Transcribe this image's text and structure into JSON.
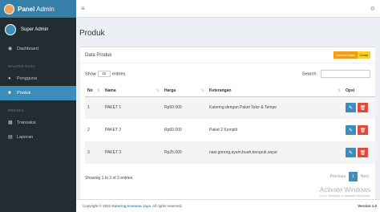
{
  "brand": {
    "bold": "Panel",
    "light": "Admin"
  },
  "user": {
    "name": "Super Admin"
  },
  "sidebar": {
    "dashboard": "Dashboard",
    "master_header": "MASTER DATA",
    "pengguna": "Pengguna",
    "produk": "Produk",
    "proses_header": "PROSES",
    "transaksi": "Transaksi",
    "laporan": "Laporan"
  },
  "page": {
    "title": "Produk",
    "card_title": "Data Produk",
    "btn_add": "Tambah Data",
    "btn_add2": "Cetak"
  },
  "controls": {
    "show": "Show",
    "show_value": "10",
    "entries": "entries",
    "search": "Search:"
  },
  "table": {
    "headers": [
      "No",
      "Nama",
      "Harga",
      "Keterangan",
      "Opsi"
    ],
    "rows": [
      {
        "no": "1",
        "nama": "PAKET 1",
        "harga": "Rp50.000",
        "keterangan": "Katering dengan Paket Telor & Tempe"
      },
      {
        "no": "2",
        "nama": "PAKET 2",
        "harga": "Rp60.000",
        "keterangan": "Paket 2 Komplit"
      },
      {
        "no": "3",
        "nama": "PAKET 3",
        "harga": "Rp25.000",
        "keterangan": "nasi goreng,ayam,buah,kerupuk,sayur"
      }
    ]
  },
  "info": "Showing 1 to 3 of 3 entries",
  "pager": {
    "prev": "Previous",
    "page": "1",
    "next": "Next"
  },
  "footer": {
    "prefix": "Copyright © 2022",
    "brand": "Katering Kusuma Jaya",
    "suffix": ". All rights reserved.",
    "version": "Version 1.0"
  },
  "watermark": {
    "title": "Activate Windows",
    "sub": "Go to Settings to activate Windows."
  }
}
